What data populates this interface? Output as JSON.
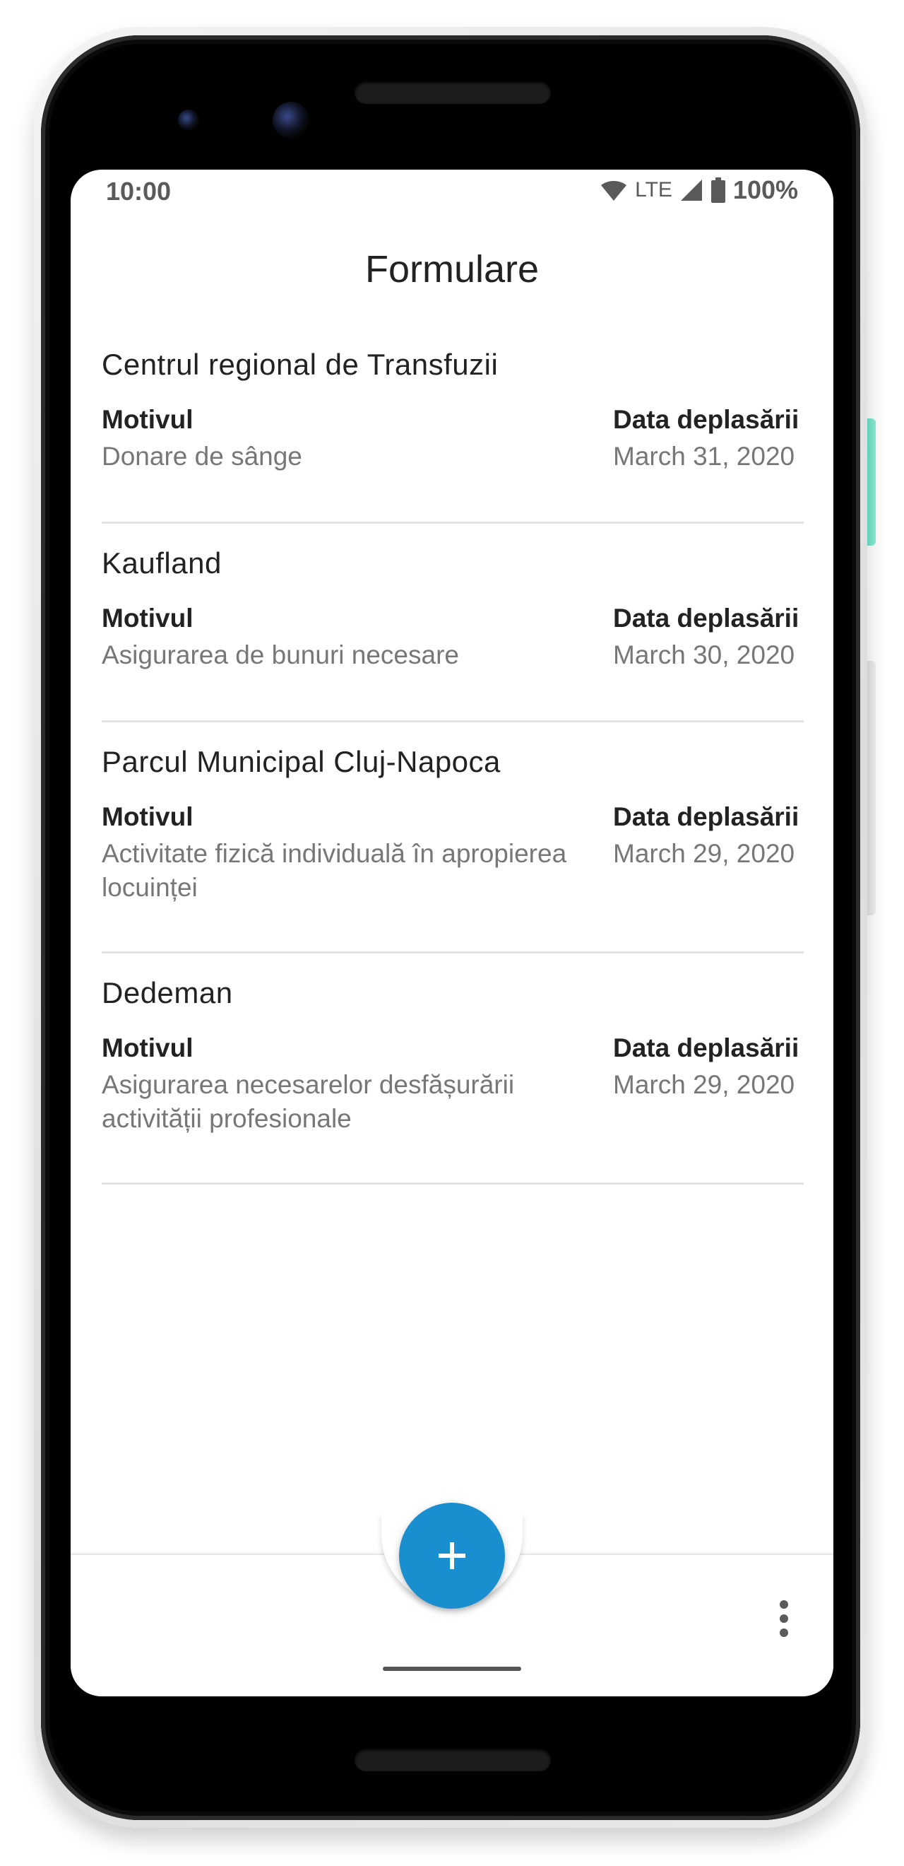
{
  "status_bar": {
    "time": "10:00",
    "network": "LTE",
    "battery": "100%",
    "icons": [
      "wifi-icon",
      "signal-icon",
      "battery-icon"
    ]
  },
  "header": {
    "title": "Formulare"
  },
  "forms": [
    {
      "title": "Centrul regional de Transfuzii",
      "reason_label": "Motivul",
      "reason": "Donare de sânge",
      "date_label": "Data deplasării",
      "date": "March 31, 2020"
    },
    {
      "title": "Kaufland",
      "reason_label": "Motivul",
      "reason": "Asigurarea de bunuri necesare",
      "date_label": "Data deplasării",
      "date": "March 30, 2020"
    },
    {
      "title": "Parcul Municipal Cluj-Napoca",
      "reason_label": "Motivul",
      "reason": "Activitate fizică individuală în apropierea locuinței",
      "date_label": "Data deplasării",
      "date": "March 29, 2020"
    },
    {
      "title": "Dedeman",
      "reason_label": "Motivul",
      "reason": "Asigurarea necesarelor desfășurării activității profesionale",
      "date_label": "Data deplasării",
      "date": "March 29, 2020"
    }
  ],
  "bottom_bar": {
    "fab_icon": "plus-icon",
    "menu_icon": "more-vertical-icon"
  },
  "colors": {
    "accent": "#1a8fd0",
    "text_primary": "#222222",
    "text_secondary": "#777777",
    "divider": "#e2e2e2"
  }
}
